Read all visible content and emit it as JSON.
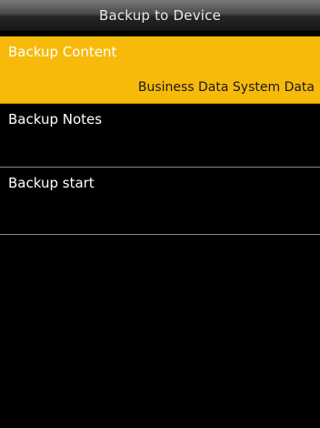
{
  "header": {
    "title": "Backup to Device"
  },
  "menu": {
    "items": [
      {
        "label": "Backup Content",
        "value": "Business Data System Data",
        "selected": true
      },
      {
        "label": "Backup Notes",
        "value": ""
      },
      {
        "label": "Backup start",
        "value": ""
      }
    ]
  },
  "colors": {
    "highlight": "#f7ba0b",
    "background": "#000000",
    "separator": "#8a8a8a"
  }
}
